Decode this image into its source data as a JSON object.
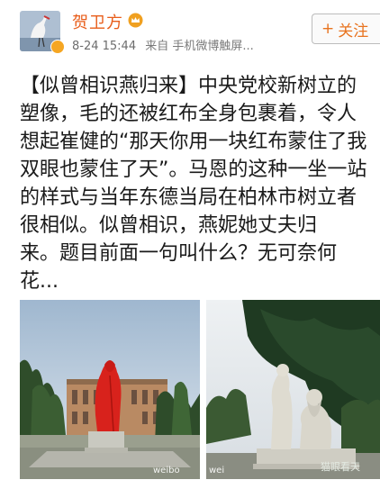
{
  "post": {
    "author": {
      "name": "贺卫方"
    },
    "timestamp": "8-24 15:44",
    "source": "来自 手机微博触屏...",
    "follow_label": "关注",
    "text_lines": [
      "【似曾相识燕归来】中央党校新树立的",
      "塑像，毛的还被红布全身包裹着，令人",
      "想起崔健的“那天你用一块红布蒙住了我",
      "双眼也蒙住了天”。马恩的这种一坐一站",
      "的样式与当年东德当局在柏林市树立者",
      "很相似。似曾相识，燕妮她丈夫归",
      "来。题目前面一句叫什么？无可奈何",
      "花..."
    ]
  },
  "images": [
    {
      "watermark": "weibo"
    },
    {
      "watermark_left": "wei",
      "watermark_right": "猫眼看天",
      "watermark_bottom": "@猫眼看天"
    }
  ],
  "colors": {
    "name": "#e85d1a",
    "follow": "#e8731f",
    "meta": "#7a7a7a",
    "statue_red": "#d8221c"
  }
}
